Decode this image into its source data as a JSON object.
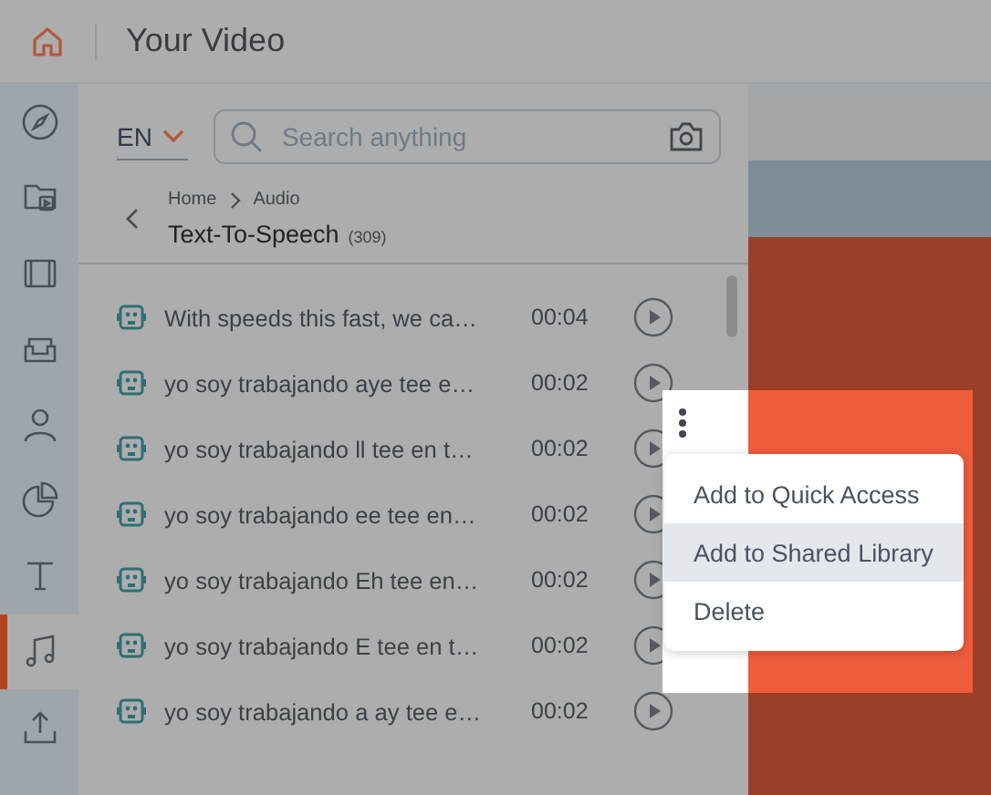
{
  "header": {
    "title": "Your Video"
  },
  "rail": [
    {
      "kind": "compass",
      "selected": false
    },
    {
      "kind": "folder",
      "selected": false
    },
    {
      "kind": "film",
      "selected": false
    },
    {
      "kind": "sofa",
      "selected": false
    },
    {
      "kind": "person",
      "selected": false
    },
    {
      "kind": "pie",
      "selected": false
    },
    {
      "kind": "text",
      "selected": false
    },
    {
      "kind": "music",
      "selected": true
    },
    {
      "kind": "upload",
      "selected": false
    }
  ],
  "language": "EN",
  "search": {
    "placeholder": "Search anything"
  },
  "breadcrumb": [
    "Home",
    "Audio"
  ],
  "section": {
    "title": "Text-To-Speech",
    "count": "(309)"
  },
  "items": [
    {
      "title": "With speeds this fast, we ca…",
      "duration": "00:04",
      "menu_open": false
    },
    {
      "title": "yo soy trabajando aye tee e…",
      "duration": "00:02",
      "menu_open": true
    },
    {
      "title": "yo soy trabajando ll tee en t…",
      "duration": "00:02",
      "menu_open": false
    },
    {
      "title": "yo soy trabajando ee tee en…",
      "duration": "00:02",
      "menu_open": false
    },
    {
      "title": "yo soy trabajando Eh tee en…",
      "duration": "00:02",
      "menu_open": false
    },
    {
      "title": "yo soy trabajando E tee en t…",
      "duration": "00:02",
      "menu_open": false
    },
    {
      "title": "yo soy trabajando a ay tee e…",
      "duration": "00:02",
      "menu_open": false
    }
  ],
  "context_menu": [
    {
      "label": "Add to Quick Access",
      "highlighted": false
    },
    {
      "label": "Add to Shared Library",
      "highlighted": true
    },
    {
      "label": "Delete",
      "highlighted": false
    }
  ]
}
